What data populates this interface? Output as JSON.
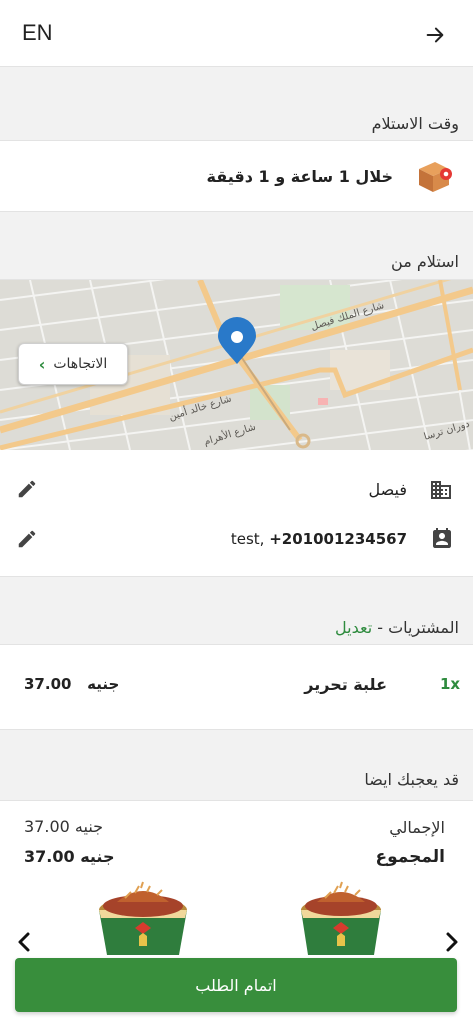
{
  "header": {
    "language": "EN",
    "back_icon": "arrow-right-icon"
  },
  "pickup_time": {
    "title": "وقت الاستلام",
    "value": "خلال 1 ساعة و 1 دقيقة",
    "icon": "package-icon"
  },
  "pickup_from": {
    "title": "استلام من",
    "directions_label": "الاتجاهات",
    "map_labels": [
      "شارع الملك فيصل",
      "شارع خالد أمين",
      "شارع الأهرام",
      "دوران ترسا"
    ],
    "branch": "فيصل",
    "contact_name": "test,",
    "contact_phone": "+201001234567"
  },
  "purchases": {
    "title": "المشتريات",
    "separator": " - ",
    "edit_label": "تعديل",
    "items": [
      {
        "qty": "1x",
        "name": "علبة تحرير",
        "price": "37.00",
        "currency": "جنيه"
      }
    ]
  },
  "suggestions": {
    "title": "قد يعجبك ايضا"
  },
  "summary": {
    "total_label": "الإجمالي",
    "total_value": "37.00",
    "total_currency": "جنيه",
    "sum_label": "المجموع",
    "sum_value": "37.00",
    "sum_currency": "جنيه"
  },
  "checkout": {
    "label": "اتمام الطلب"
  },
  "colors": {
    "accent": "#388e3c",
    "edit_text": "#2e8b3e",
    "marker": "#2979c9"
  }
}
